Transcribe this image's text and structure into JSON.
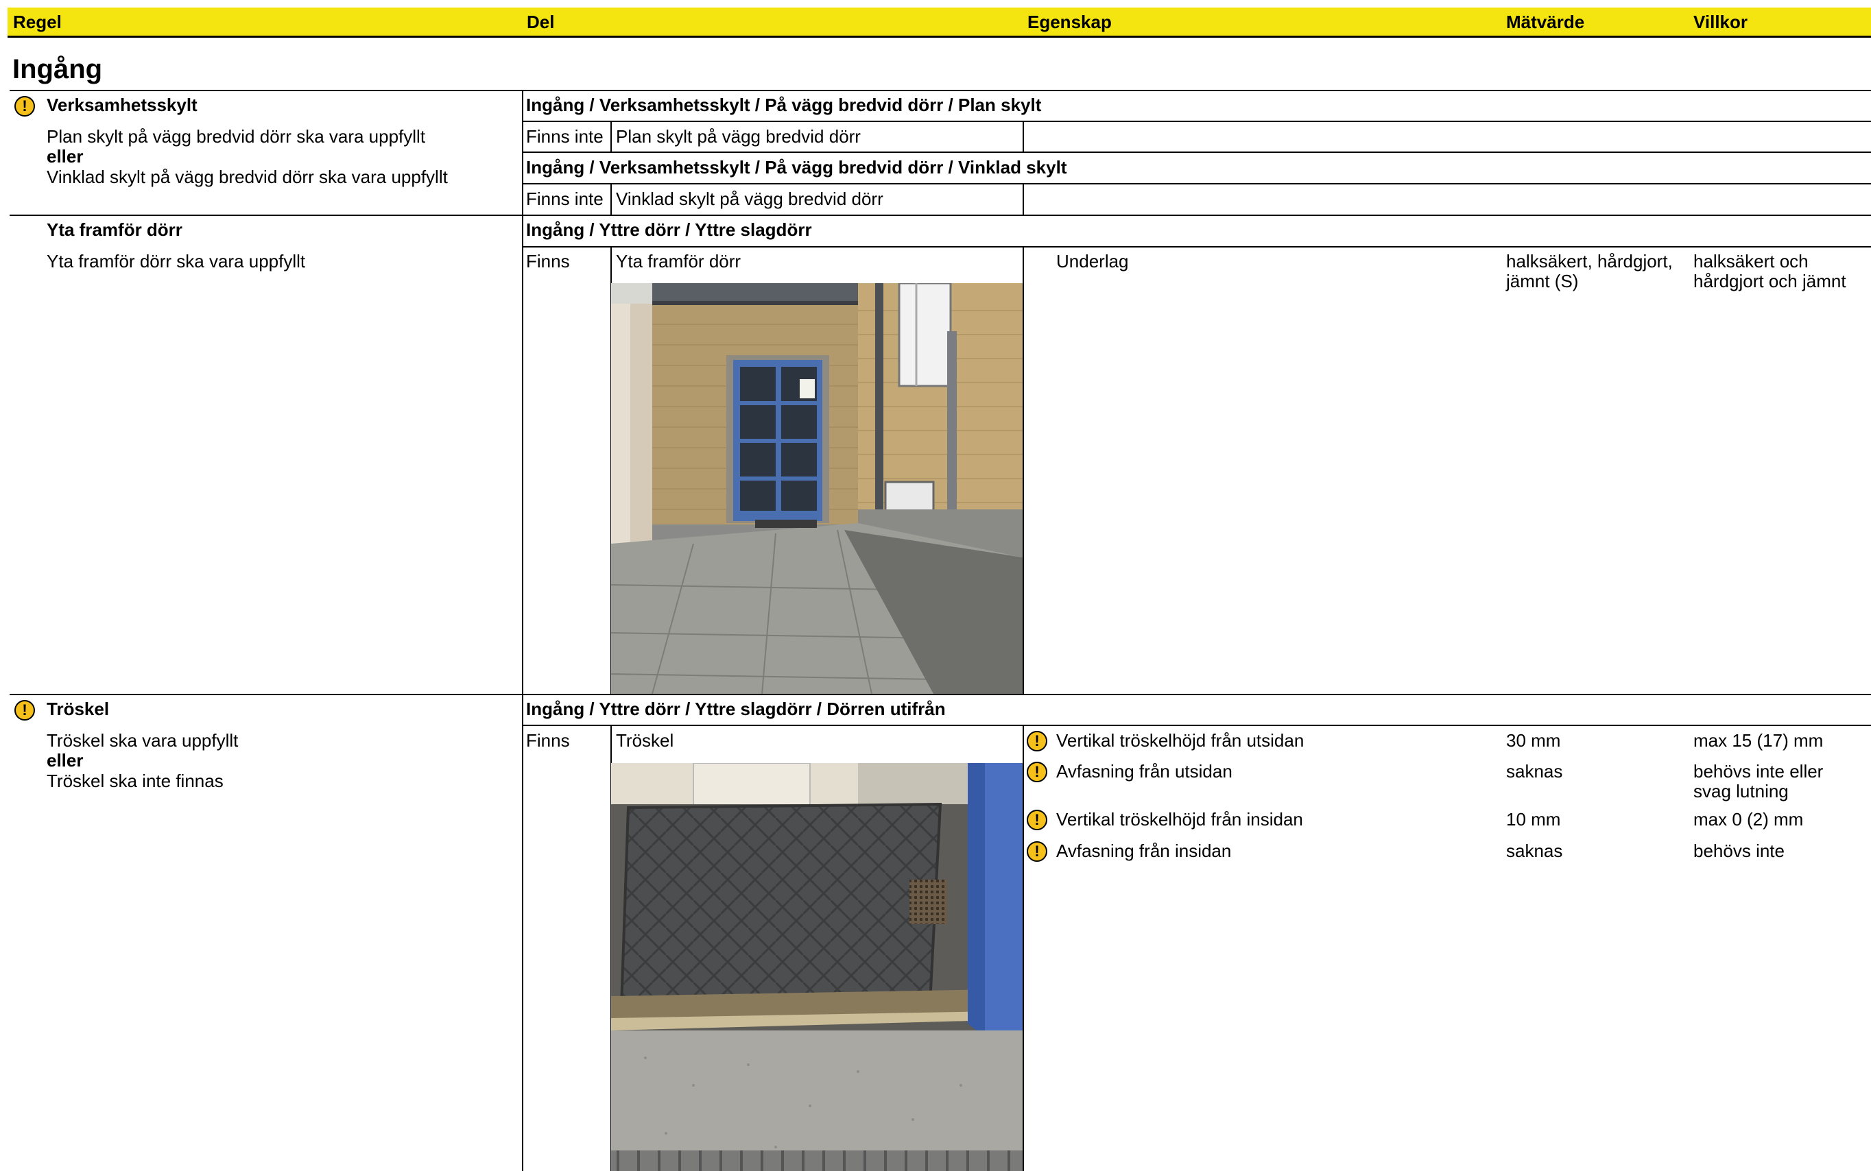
{
  "header": {
    "regel": "Regel",
    "del": "Del",
    "egenskap": "Egenskap",
    "matvarde": "Mätvärde",
    "villkor": "Villkor"
  },
  "section_title": "Ingång",
  "rules": [
    {
      "title": "Verksamhetsskylt",
      "line1": "Plan skylt på vägg bredvid dörr ska vara uppfyllt",
      "connector": "eller",
      "line2": "Vinklad skylt på vägg bredvid dörr ska vara uppfyllt",
      "parts": [
        {
          "path": "Ingång / Verksamhetsskylt  / På vägg bredvid dörr / Plan skylt",
          "status": "Finns inte",
          "name": "Plan skylt på vägg bredvid dörr"
        },
        {
          "path": "Ingång / Verksamhetsskylt  / På vägg bredvid dörr / Vinklad skylt",
          "status": "Finns inte",
          "name": "Vinklad skylt på vägg bredvid dörr"
        }
      ]
    },
    {
      "title": "Yta framför dörr",
      "line1": "Yta framför dörr ska vara uppfyllt",
      "parts": [
        {
          "path": "Ingång / Yttre dörr / Yttre slagdörr",
          "status": "Finns",
          "name": "Yta framför dörr"
        }
      ],
      "properties": [
        {
          "egenskap": "Underlag",
          "matvarde_1": "halksäkert, hårdgjort,",
          "matvarde_2": "jämnt (S)",
          "villkor_1": "halksäkert och",
          "villkor_2": "hårdgjort och jämnt"
        }
      ]
    },
    {
      "title": "Tröskel",
      "line1": "Tröskel ska vara uppfyllt",
      "connector": "eller",
      "line2": "Tröskel ska inte finnas",
      "parts": [
        {
          "path": "Ingång / Yttre dörr / Yttre slagdörr  / Dörren utifrån",
          "status": "Finns",
          "name": "Tröskel"
        }
      ],
      "properties": [
        {
          "egenskap": "Vertikal tröskelhöjd från utsidan",
          "matvarde": "30 mm",
          "villkor": "max 15 (17) mm"
        },
        {
          "egenskap": "Avfasning från utsidan",
          "matvarde": "saknas",
          "villkor_1": "behövs inte eller",
          "villkor_2": "svag lutning"
        },
        {
          "egenskap": "Vertikal tröskelhöjd från insidan",
          "matvarde": "10 mm",
          "villkor": "max 0 (2) mm"
        },
        {
          "egenskap": "Avfasning från insidan",
          "matvarde": "saknas",
          "villkor": "behövs inte"
        }
      ]
    }
  ],
  "colors": {
    "header_bg": "#f4e40f",
    "warning_icon": "#f6c01b"
  }
}
